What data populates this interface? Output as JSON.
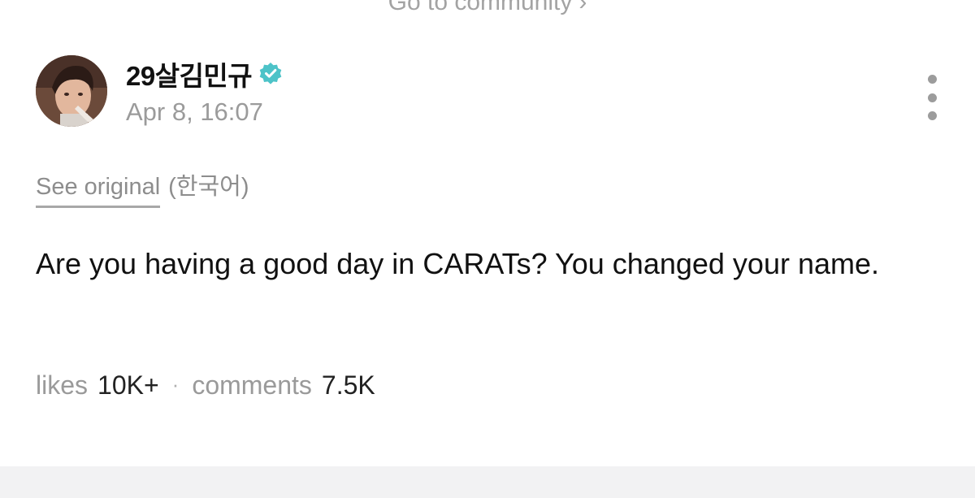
{
  "header": {
    "go_to_community": "Go to community",
    "chevron": "›"
  },
  "author": {
    "name": "29살김민규",
    "verified": true,
    "timestamp": "Apr 8, 16:07",
    "avatar_icon": "profile-photo"
  },
  "menu": {
    "icon": "more-vertical-icon"
  },
  "translation": {
    "see_original": "See original",
    "language": "(한국어)"
  },
  "post": {
    "text": "Are you having a good day in CARATs? You changed your name."
  },
  "stats": {
    "likes_label": "likes",
    "likes_value": "10K+",
    "separator": "·",
    "comments_label": "comments",
    "comments_value": "7.5K"
  },
  "colors": {
    "verified_badge": "#4dc3c8",
    "muted_text": "#9b9b9b",
    "footer_band": "#f2f2f3"
  }
}
